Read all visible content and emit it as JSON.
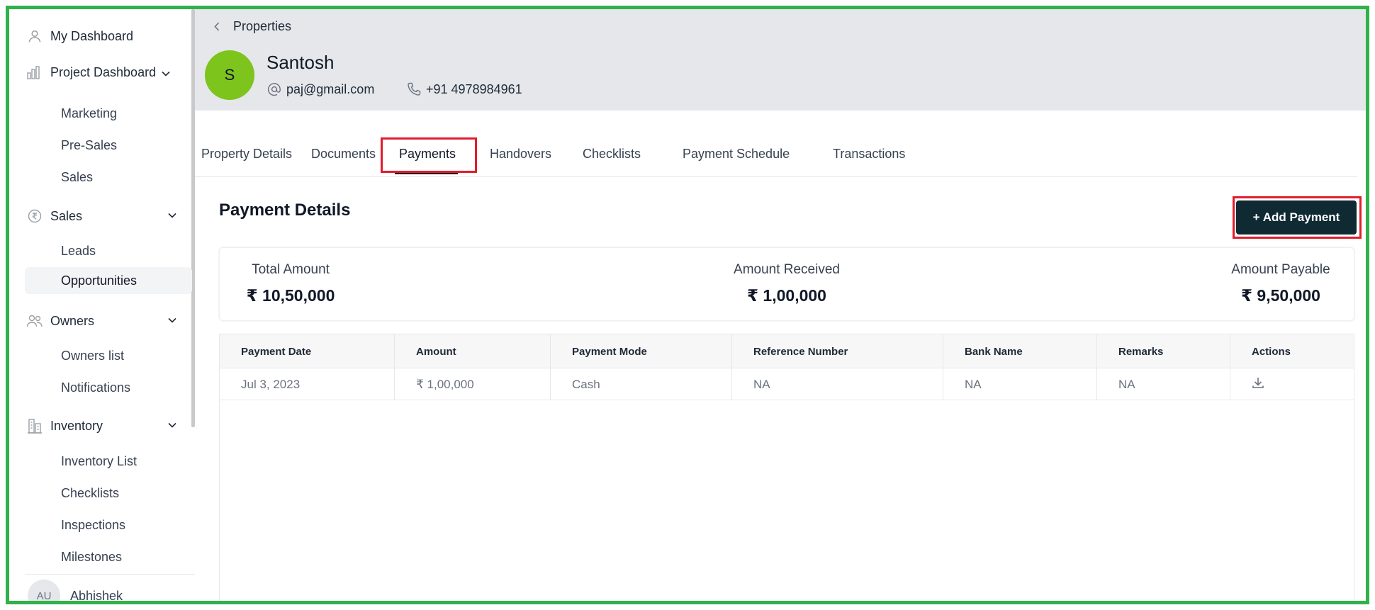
{
  "sidebar": {
    "my_dashboard": "My Dashboard",
    "project_dashboard": "Project Dashboard",
    "project_items": [
      "Marketing",
      "Pre-Sales",
      "Sales"
    ],
    "sales": "Sales",
    "sales_items": [
      "Leads",
      "Opportunities"
    ],
    "owners": "Owners",
    "owners_items": [
      "Owners list",
      "Notifications"
    ],
    "inventory": "Inventory",
    "inventory_items": [
      "Inventory List",
      "Checklists",
      "Inspections",
      "Milestones"
    ],
    "user_initials": "AU",
    "user_name": "Abhishek"
  },
  "header": {
    "breadcrumb": "Properties",
    "avatar_letter": "S",
    "customer_name": "Santosh",
    "email": "paj@gmail.com",
    "phone": "+91 4978984961"
  },
  "tabs": [
    "Property Details",
    "Documents",
    "Payments",
    "Handovers",
    "Checklists",
    "Payment Schedule",
    "Transactions"
  ],
  "active_tab": "Payments",
  "payment_details": {
    "title": "Payment Details",
    "add_button": "+ Add Payment",
    "total_amount_label": "Total Amount",
    "total_amount": "₹ 10,50,000",
    "amount_received_label": "Amount Received",
    "amount_received": "₹ 1,00,000",
    "amount_payable_label": "Amount Payable",
    "amount_payable": "₹ 9,50,000"
  },
  "table": {
    "columns": [
      "Payment Date",
      "Amount",
      "Payment Mode",
      "Reference Number",
      "Bank Name",
      "Remarks",
      "Actions"
    ],
    "rows": [
      [
        "Jul 3, 2023",
        "₹ 1,00,000",
        "Cash",
        "NA",
        "NA",
        "NA"
      ]
    ]
  },
  "colors": {
    "frame": "#2fb24a",
    "highlight": "#e11d2b",
    "avatar": "#7dc41c",
    "button": "#0f2a33"
  }
}
